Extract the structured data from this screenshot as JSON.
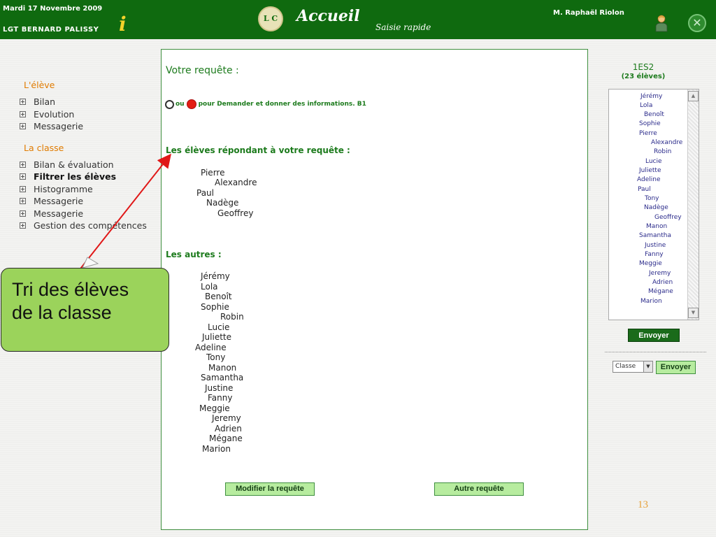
{
  "header": {
    "date": "Mardi 17 Novembre 2009",
    "school": "LGT BERNARD PALISSY",
    "info_icon": "i",
    "logo_text": "L C",
    "title": "Accueil",
    "subtitle": "Saisie rapide",
    "user": "M. Raphaël Riolon"
  },
  "sidebar": {
    "section1": "L'élève",
    "items1": [
      "Bilan",
      "Evolution",
      "Messagerie"
    ],
    "section2": "La classe",
    "items2": [
      "Bilan & évaluation",
      "Filtrer les élèves",
      "Histogramme",
      "Messagerie",
      "Messagerie",
      "Gestion des compétences"
    ],
    "active_item": "Filtrer les élèves"
  },
  "main": {
    "request_title": "Votre requête :",
    "request_or": "ou",
    "request_text": "pour Demander et donner des informations. B1",
    "matching_title": "Les élèves répondant à votre requête :",
    "matching_students": [
      "Pierre",
      "Alexandre",
      "Paul",
      "Nadège",
      "Geoffrey"
    ],
    "others_title": "Les autres :",
    "other_students": [
      "Jérémy",
      "Lola",
      "Benoît",
      "Sophie",
      "Robin",
      "Lucie",
      "Juliette",
      "Adeline",
      "Tony",
      "Manon",
      "Samantha",
      "Justine",
      "Fanny",
      "Meggie",
      "Jeremy",
      "Adrien",
      "Mégane",
      "Marion"
    ],
    "modify_button": "Modifier la requête",
    "other_request_button": "Autre requête"
  },
  "right_panel": {
    "class_name": "1ES2",
    "student_count": "(23 élèves)",
    "student_list": [
      "Jérémy",
      "Lola",
      "Benoît",
      "Sophie",
      "Pierre",
      "Alexandre",
      "Robin",
      "Lucie",
      "Juliette",
      "Adeline",
      "Paul",
      "Tony",
      "Nadège",
      "Geoffrey",
      "Manon",
      "Samantha",
      "Justine",
      "Fanny",
      "Meggie",
      "Jeremy",
      "Adrien",
      "Mégane",
      "Marion"
    ],
    "send_button": "Envoyer",
    "select_value": "Classe",
    "send_button2": "Envoyer"
  },
  "callout": {
    "line1": "Tri des élèves",
    "line2": "de la classe"
  },
  "page_number": "13",
  "colors": {
    "header_green": "#0f6a0f",
    "accent_orange": "#e07b00",
    "heading_green": "#1d7b1d",
    "callout_green": "#9bd35b",
    "arrow_red": "#e01818"
  }
}
